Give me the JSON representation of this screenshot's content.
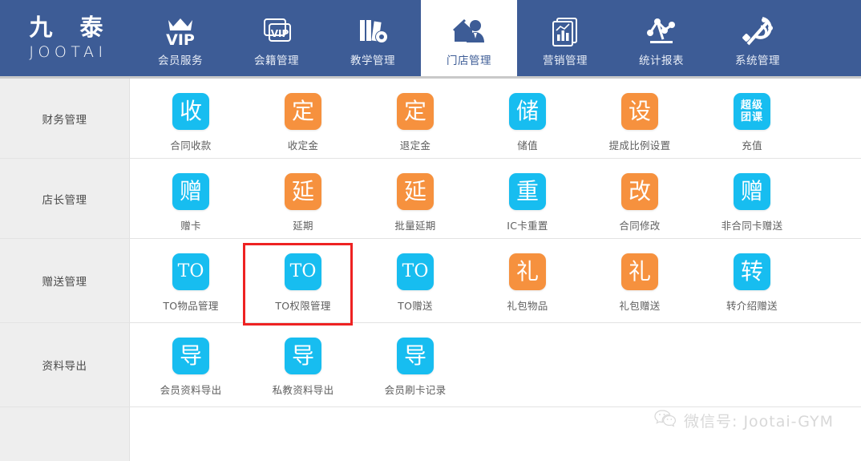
{
  "brand": {
    "name_cn": "九 泰",
    "name_en": "JOOTAI"
  },
  "topnav": {
    "items": [
      {
        "label": "会员服务",
        "icon": "vip-crown-icon",
        "active": false
      },
      {
        "label": "会籍管理",
        "icon": "vip-cards-icon",
        "active": false
      },
      {
        "label": "教学管理",
        "icon": "books-gear-icon",
        "active": false
      },
      {
        "label": "门店管理",
        "icon": "store-person-icon",
        "active": true
      },
      {
        "label": "营销管理",
        "icon": "report-chart-icon",
        "active": false
      },
      {
        "label": "统计报表",
        "icon": "line-chart-icon",
        "active": false
      },
      {
        "label": "系统管理",
        "icon": "gears-wrench-icon",
        "active": false
      }
    ]
  },
  "colors": {
    "nav_background": "#3d5c96",
    "tile_blue": "#17bdf0",
    "tile_orange": "#f6913e",
    "highlight_red": "#ee2222",
    "sidebar_background": "#eeeeee"
  },
  "rows": [
    {
      "category": "财务管理",
      "tiles": [
        {
          "glyph": "收",
          "label": "合同收款",
          "color": "blue"
        },
        {
          "glyph": "定",
          "label": "收定金",
          "color": "orange"
        },
        {
          "glyph": "定",
          "label": "退定金",
          "color": "orange"
        },
        {
          "glyph": "储",
          "label": "储值",
          "color": "blue"
        },
        {
          "glyph": "设",
          "label": "提成比例设置",
          "color": "orange"
        },
        {
          "glyph": "超级团课",
          "label": "充值",
          "color": "blue",
          "style": "quad"
        }
      ]
    },
    {
      "category": "店长管理",
      "tiles": [
        {
          "glyph": "赠",
          "label": "赠卡",
          "color": "blue"
        },
        {
          "glyph": "延",
          "label": "延期",
          "color": "orange"
        },
        {
          "glyph": "延",
          "label": "批量延期",
          "color": "orange"
        },
        {
          "glyph": "重",
          "label": "IC卡重置",
          "color": "blue"
        },
        {
          "glyph": "改",
          "label": "合同修改",
          "color": "orange"
        },
        {
          "glyph": "赠",
          "label": "非合同卡赠送",
          "color": "blue"
        }
      ]
    },
    {
      "category": "赠送管理",
      "tiles": [
        {
          "glyph": "TO",
          "label": "TO物品管理",
          "color": "blue",
          "style": "latin"
        },
        {
          "glyph": "TO",
          "label": "TO权限管理",
          "color": "blue",
          "style": "latin",
          "highlighted": true
        },
        {
          "glyph": "TO",
          "label": "TO赠送",
          "color": "blue",
          "style": "latin"
        },
        {
          "glyph": "礼",
          "label": "礼包物品",
          "color": "orange"
        },
        {
          "glyph": "礼",
          "label": "礼包赠送",
          "color": "orange"
        },
        {
          "glyph": "转",
          "label": "转介绍赠送",
          "color": "blue"
        }
      ]
    },
    {
      "category": "资料导出",
      "tiles": [
        {
          "glyph": "导",
          "label": "会员资料导出",
          "color": "blue"
        },
        {
          "glyph": "导",
          "label": "私教资料导出",
          "color": "blue"
        },
        {
          "glyph": "导",
          "label": "会员刷卡记录",
          "color": "blue"
        }
      ]
    },
    {
      "category": "",
      "tiles": []
    }
  ],
  "watermark": {
    "icon": "wechat-icon",
    "text": "微信号: Jootai-GYM"
  }
}
